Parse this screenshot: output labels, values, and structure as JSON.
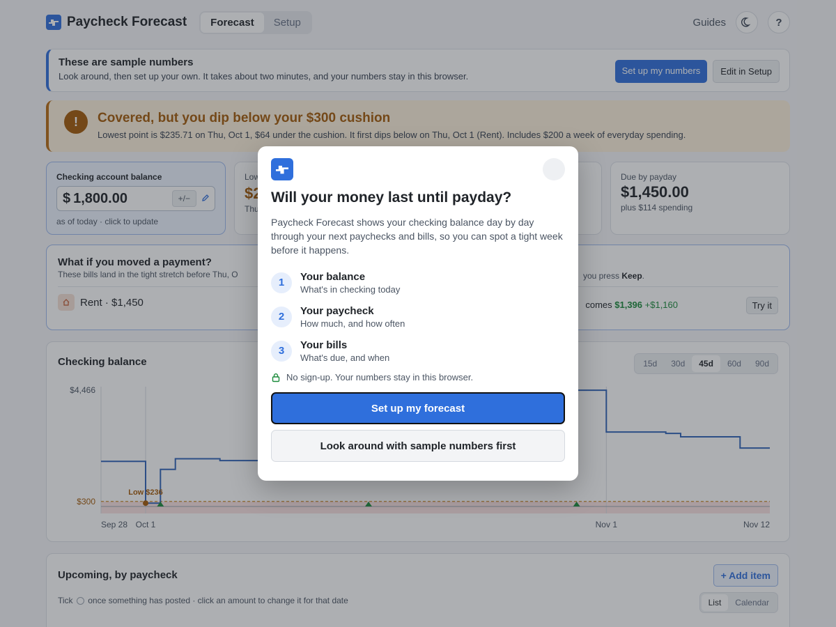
{
  "app": {
    "title": "Paycheck Forecast"
  },
  "nav": {
    "tabs": [
      "Forecast",
      "Setup"
    ],
    "active_tab": "Forecast",
    "guides": "Guides",
    "theme_icon": "moon-icon",
    "help": "?"
  },
  "sample_banner": {
    "title": "These are sample numbers",
    "subtitle": "Look around, then set up your own. It takes about two minutes, and your numbers stay in this browser.",
    "primary_button": "Set up my numbers",
    "secondary_button": "Edit in Setup"
  },
  "warning": {
    "icon": "!",
    "title": "Covered, but you dip below your $300 cushion",
    "detail": "Lowest point is $235.71 on Thu, Oct 1, $64 under the cushion. It first dips below on Thu, Oct 1 (Rent). Includes $200 a week of everyday spending."
  },
  "balance_card": {
    "label": "Checking account balance",
    "currency": "$",
    "value": "1,800.00",
    "adjust": "+/−",
    "updated": "as of today · click to update"
  },
  "low_card": {
    "label": "Low",
    "value": "$2",
    "sub": "Thu"
  },
  "due_card": {
    "label": "Due by payday",
    "value": "$1,450.00",
    "sub": "plus $114 spending"
  },
  "what_if": {
    "title": "What if you moved a payment?",
    "subtitle": "These bills land in the tight stretch before Thu, O",
    "keep_prefix": "you press ",
    "keep_bold": "Keep",
    "keep_suffix": ".",
    "item": "Rent · $1,450",
    "becomes_prefix": "comes ",
    "becomes_value": "$1,396",
    "becomes_delta": "+$1,160",
    "try": "Try it"
  },
  "chart_card": {
    "title": "Checking balance",
    "ranges": [
      "15d",
      "30d",
      "45d",
      "60d",
      "90d"
    ],
    "active_range": "45d"
  },
  "chart_data": {
    "type": "line",
    "ylabel_ticks": [
      "$4,466",
      "$300"
    ],
    "cushion_label": "$300",
    "low_label": "Low $236",
    "x_ticks": [
      "Sep 28",
      "Oct 1",
      "Nov 1",
      "Nov 12"
    ],
    "series": [
      {
        "points": [
          [
            "Sep 28",
            1800
          ],
          [
            "Oct 1",
            1800
          ],
          [
            "Oct 1",
            236
          ],
          [
            "Oct 2",
            236
          ],
          [
            "Oct 2",
            1500
          ],
          [
            "Oct 3",
            1500
          ],
          [
            "Oct 3",
            1900
          ],
          [
            "Oct 6",
            1900
          ],
          [
            "Oct 6",
            1830
          ],
          [
            "Oct 10",
            1830
          ],
          [
            "Oct 30",
            4466
          ],
          [
            "Nov 1",
            4466
          ],
          [
            "Nov 1",
            2900
          ],
          [
            "Nov 5",
            2900
          ],
          [
            "Nov 5",
            2850
          ],
          [
            "Nov 6",
            2850
          ],
          [
            "Nov 6",
            2720
          ],
          [
            "Nov 10",
            2720
          ],
          [
            "Nov 10",
            2300
          ],
          [
            "Nov 12",
            2300
          ]
        ]
      }
    ],
    "cushion": 300,
    "paydays": [
      "Oct 2",
      "Oct 16",
      "Oct 30"
    ]
  },
  "upcoming": {
    "title": "Upcoming, by paycheck",
    "add": "+ Add item",
    "hint_prefix": "Tick",
    "hint_suffix": "once something has posted · click an amount to change it for that date",
    "views": [
      "List",
      "Calendar"
    ],
    "active_view": "List"
  },
  "modal": {
    "title": "Will your money last until payday?",
    "intro": "Paycheck Forecast shows your checking balance day by day through your next paychecks and bills, so you can spot a tight week before it happens.",
    "steps": [
      {
        "num": "1",
        "heading": "Your balance",
        "desc": "What's in checking today"
      },
      {
        "num": "2",
        "heading": "Your paycheck",
        "desc": "How much, and how often"
      },
      {
        "num": "3",
        "heading": "Your bills",
        "desc": "What's due, and when"
      }
    ],
    "privacy": "No sign-up. Your numbers stay in this browser.",
    "primary": "Set up my forecast",
    "secondary": "Look around with sample numbers first"
  }
}
